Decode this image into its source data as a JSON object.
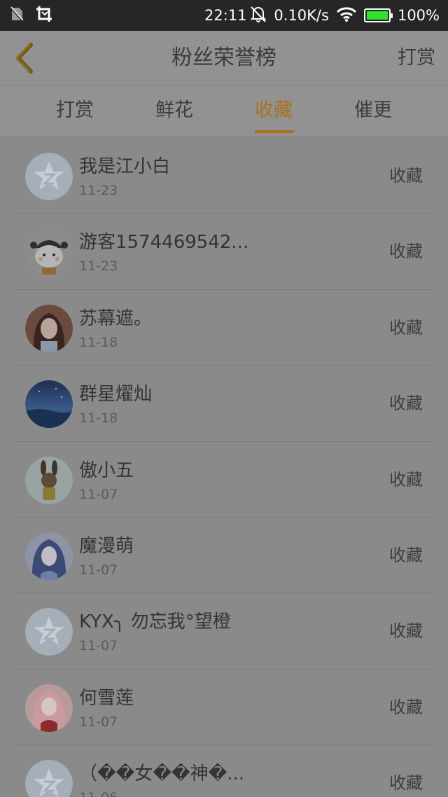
{
  "status_bar": {
    "time": "22:11",
    "network_speed": "0.10K/s",
    "battery": "100%",
    "battery_level": 1.0,
    "icons": [
      "no-sim-icon",
      "screenshot-crop-icon",
      "bell-muted-icon",
      "wifi-icon",
      "battery-icon"
    ]
  },
  "header": {
    "title": "粉丝荣誉榜",
    "action": "打赏"
  },
  "tabs": [
    {
      "label": "打赏",
      "active": false
    },
    {
      "label": "鲜花",
      "active": false
    },
    {
      "label": "收藏",
      "active": true
    },
    {
      "label": "催更",
      "active": false
    }
  ],
  "colors": {
    "accent": "#a9721a",
    "battery": "#2ee22e",
    "default_avatar": "#a8b3bd"
  },
  "list": [
    {
      "name": "我是江小白",
      "date": "11-23",
      "action": "收藏",
      "avatar": "default-avatar-icon"
    },
    {
      "name": "游客1574469542...",
      "date": "11-23",
      "action": "收藏",
      "avatar": "cartoon-avatar"
    },
    {
      "name": "苏幕遮。",
      "date": "11-18",
      "action": "收藏",
      "avatar": "portrait-avatar"
    },
    {
      "name": "群星燿灿",
      "date": "11-18",
      "action": "收藏",
      "avatar": "night-sky-avatar"
    },
    {
      "name": "傲小五",
      "date": "11-07",
      "action": "收藏",
      "avatar": "rabbit-avatar"
    },
    {
      "name": "魔漫萌",
      "date": "11-07",
      "action": "收藏",
      "avatar": "anime-avatar"
    },
    {
      "name": "KYX╮ 勿忘我°望橙",
      "date": "11-07",
      "action": "收藏",
      "avatar": "default-avatar-icon"
    },
    {
      "name": "何雪莲",
      "date": "11-07",
      "action": "收藏",
      "avatar": "anime-girl-avatar"
    },
    {
      "name": "（��女��神�...",
      "date": "11-06",
      "action": "收藏",
      "avatar": "default-avatar-icon"
    }
  ]
}
